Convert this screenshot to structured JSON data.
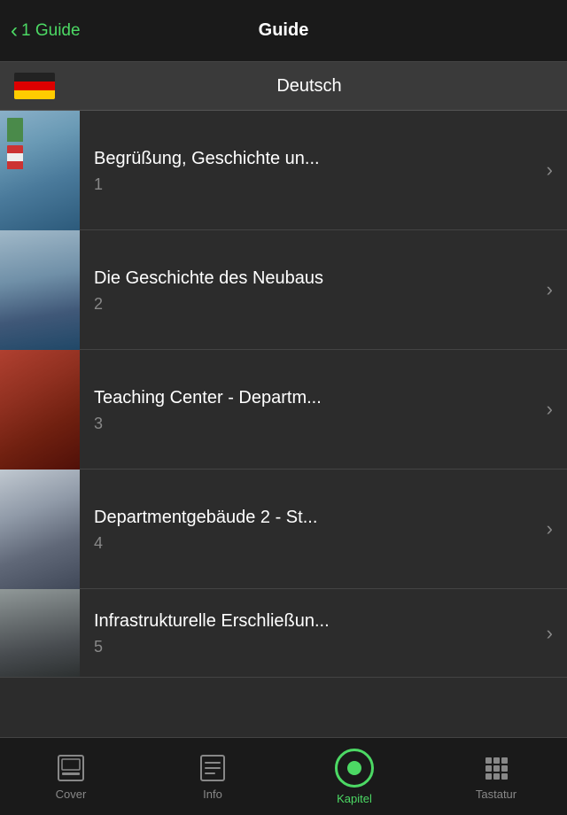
{
  "header": {
    "back_label": "1 Guide",
    "title": "Guide"
  },
  "language_bar": {
    "language": "Deutsch"
  },
  "items": [
    {
      "id": 1,
      "title": "Begrüßung, Geschichte un...",
      "number": "1",
      "thumb_class": "thumb-1",
      "has_flags": true
    },
    {
      "id": 2,
      "title": "Die Geschichte des Neubaus",
      "number": "2",
      "thumb_class": "thumb-2",
      "has_flags": false
    },
    {
      "id": 3,
      "title": "Teaching Center - Departm...",
      "number": "3",
      "thumb_class": "thumb-3",
      "has_flags": false
    },
    {
      "id": 4,
      "title": "Departmentgebäude 2 - St...",
      "number": "4",
      "thumb_class": "thumb-4",
      "has_flags": false
    },
    {
      "id": 5,
      "title": "Infrastrukturelle Erschließun...",
      "number": "5",
      "thumb_class": "thumb-5",
      "has_flags": false
    }
  ],
  "tabbar": {
    "tabs": [
      {
        "id": "cover",
        "label": "Cover",
        "active": false
      },
      {
        "id": "info",
        "label": "Info",
        "active": false
      },
      {
        "id": "kapitel",
        "label": "Kapitel",
        "active": true
      },
      {
        "id": "tastatur",
        "label": "Tastatur",
        "active": false
      }
    ]
  }
}
